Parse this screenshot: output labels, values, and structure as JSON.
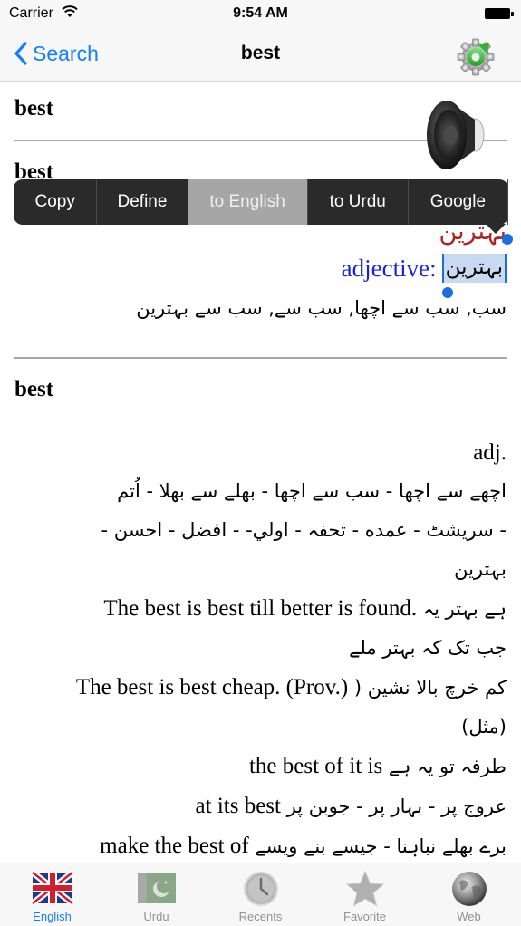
{
  "status_bar": {
    "carrier": "Carrier",
    "time": "9:54 AM"
  },
  "nav": {
    "back_label": "Search",
    "title": "best",
    "settings_icon": "gear-refresh-icon"
  },
  "entry1": {
    "headword": "best",
    "speaker_icon": "speaker-icon"
  },
  "entry2": {
    "headword": "best",
    "urdu_title": "بہترین",
    "pos_label": "adjective:",
    "selected_text": "بہترین",
    "meanings": "سب, سب سے اچھا, سب سے, سب سے بہترین"
  },
  "context_menu": {
    "items": [
      {
        "label": "Copy",
        "active": false
      },
      {
        "label": "Define",
        "active": false
      },
      {
        "label": "to English",
        "active": true
      },
      {
        "label": "to Urdu",
        "active": false
      },
      {
        "label": "Google",
        "active": false
      }
    ]
  },
  "entry3": {
    "headword": "best",
    "pos": "adj.",
    "lines": [
      {
        "urdu": "اچھے سے اچھا - سب سے اچھا - بھلے سے بھلا - اُتم",
        "english": ""
      },
      {
        "urdu": "- سریشٹ - عمده - تحفہ - اولي- - افضل - احسن -",
        "english": ""
      },
      {
        "urdu": "بہترین",
        "english": ""
      },
      {
        "urdu": "ہے بہتر یہ",
        "english": "The best is best till better is found."
      },
      {
        "urdu": "جب تک کہ بہتر ملے",
        "english": ""
      },
      {
        "urdu": "کم خرچ بالا نشین (",
        "english": "The best is best cheap. (Prov.)"
      },
      {
        "urdu": "(مثل)",
        "english": ""
      },
      {
        "urdu": "طرفہ تو یہ ہے",
        "english": "the best of it is"
      },
      {
        "urdu": "عروج پر - بہار پر - جوبن پر",
        "english": "at its best"
      },
      {
        "urdu": "برے بھلے نباہنا - جیسے بنے ویسے",
        "english": "make the best of"
      }
    ]
  },
  "tab_bar": {
    "tabs": [
      {
        "label": "English",
        "icon": "uk-flag-icon",
        "active": true
      },
      {
        "label": "Urdu",
        "icon": "pakistan-flag-icon",
        "active": false
      },
      {
        "label": "Recents",
        "icon": "clock-icon",
        "active": false
      },
      {
        "label": "Favorite",
        "icon": "star-icon",
        "active": false
      },
      {
        "label": "Web",
        "icon": "globe-icon",
        "active": false
      }
    ]
  },
  "colors": {
    "ios_blue": "#157efb",
    "pos_blue": "#1a22e0",
    "urdu_title_red": "#b22222",
    "selection_bg": "#c9daf0",
    "menu_bg": "#2a2a2a",
    "menu_active_bg": "#a6a6a6"
  }
}
